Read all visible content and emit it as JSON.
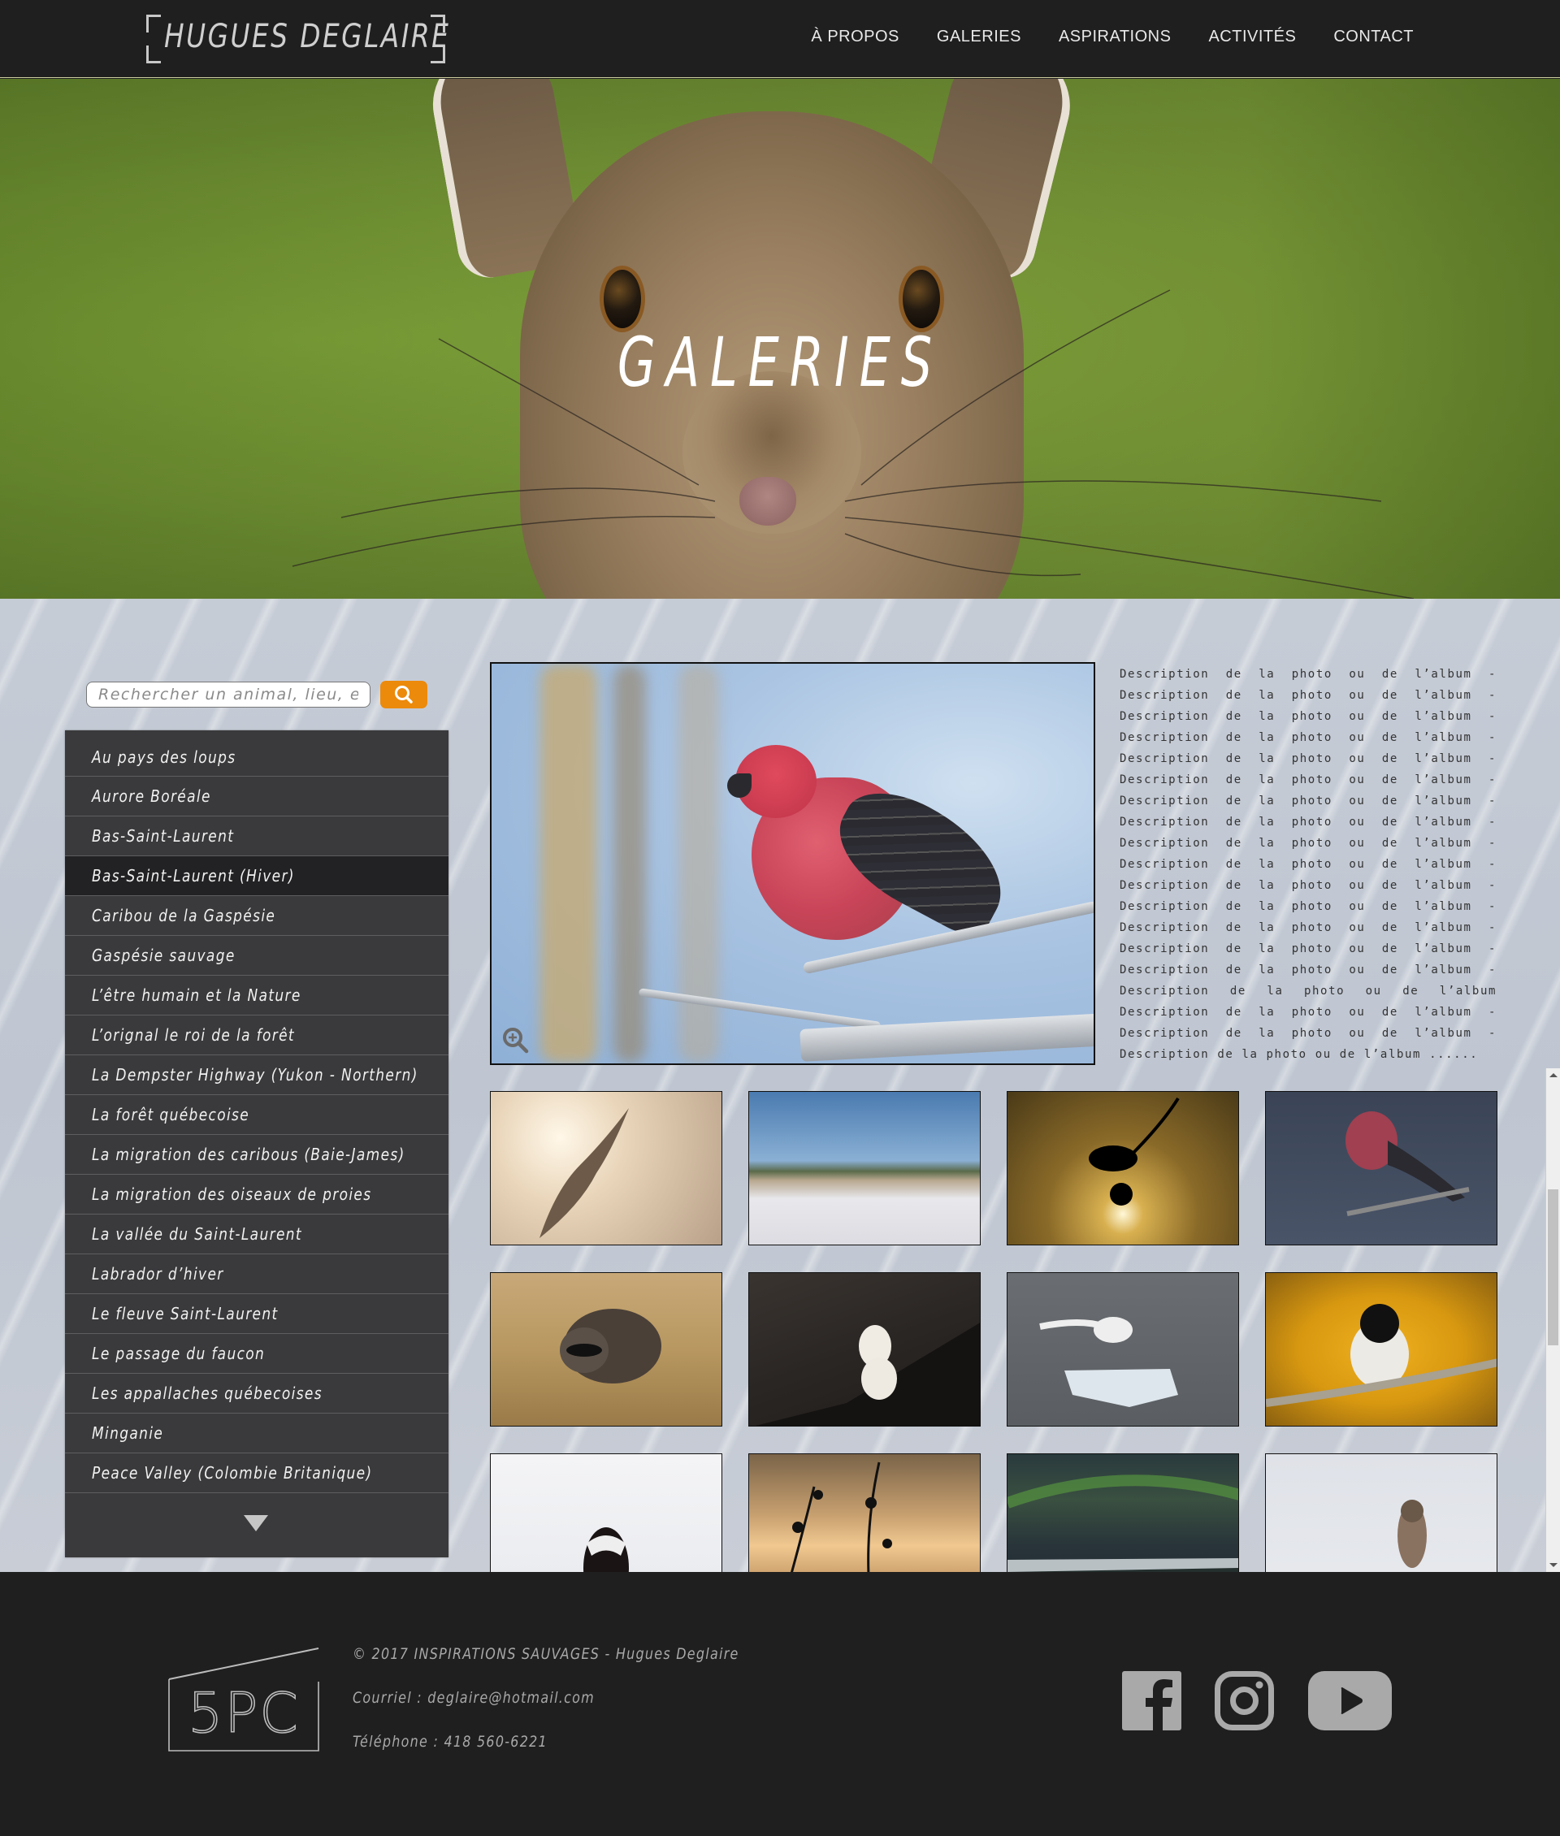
{
  "header": {
    "logo": "HUGUES DEGLAIRE",
    "nav": [
      {
        "label": "À  PROPOS"
      },
      {
        "label": "GALERIES"
      },
      {
        "label": "ASPIRATIONS"
      },
      {
        "label": "ACTIVITÉS"
      },
      {
        "label": "CONTACT"
      }
    ]
  },
  "hero": {
    "title": "GALERIES"
  },
  "search": {
    "placeholder": "Rechercher un animal, lieu, etc.",
    "value": "",
    "button_icon": "search-icon"
  },
  "galleries": {
    "items": [
      {
        "label": "Au pays des loups"
      },
      {
        "label": "Aurore Boréale"
      },
      {
        "label": "Bas-Saint-Laurent"
      },
      {
        "label": "Bas-Saint-Laurent (Hiver)",
        "active": true
      },
      {
        "label": "Caribou de la Gaspésie"
      },
      {
        "label": "Gaspésie sauvage"
      },
      {
        "label": "L’être humain et la Nature"
      },
      {
        "label": "L’orignal le roi de la forêt"
      },
      {
        "label": "La Dempster Highway (Yukon - Northern)"
      },
      {
        "label": "La forêt québecoise"
      },
      {
        "label": "La migration des caribous (Baie-James)"
      },
      {
        "label": "La migration des oiseaux de proies"
      },
      {
        "label": "La vallée du Saint-Laurent"
      },
      {
        "label": "Labrador d’hiver"
      },
      {
        "label": "Le fleuve Saint-Laurent"
      },
      {
        "label": "Le passage du faucon"
      },
      {
        "label": "Les appallaches québecoises"
      },
      {
        "label": "Minganie"
      },
      {
        "label": "Peace Valley (Colombie Britanique)"
      }
    ],
    "more_icon": "chevron-down-icon"
  },
  "featured": {
    "subject": "Pine grosbeak on branch",
    "zoom_icon": "zoom-in-icon",
    "description": "Description de la photo ou de l’album - Description de la photo ou de l’album - Description de la photo ou de l’album - Description de la photo ou de l’album - Description de la photo ou de l’album - Description de la photo ou de l’album - Description de la photo ou de l’album - Description de la photo ou de l’album - Description de la photo ou de l’album - Description de la photo ou de l’album - Description de la photo ou de l’album - Description de la photo ou de l’album - Description de la photo ou de l’album - Description de la photo ou de l’album - Description de la photo ou de l’album - Description de la photo ou de l’album Description de la photo ou de l’album - Description de la photo ou de l’album - Description de la photo ou de l’album ......"
  },
  "thumbnails": [
    {
      "subject": "Gull in flight against sun"
    },
    {
      "subject": "Flock of snow geese over field"
    },
    {
      "subject": "Bird silhouette against sun"
    },
    {
      "subject": "Pine grosbeak"
    },
    {
      "subject": "Raccoon in grass"
    },
    {
      "subject": "Ermine on rock"
    },
    {
      "subject": "Gull on ice floe"
    },
    {
      "subject": "Chickadee on branch"
    },
    {
      "subject": "Skunk in snow"
    },
    {
      "subject": "Sunset through branches"
    },
    {
      "subject": "Aurora over icy shore"
    },
    {
      "subject": "Coyote walking in snow"
    }
  ],
  "footer": {
    "logo": "5PC",
    "copyright": "© 2017 INSPIRATIONS SAUVAGES - Hugues Deglaire",
    "email": "Courriel : deglaire@hotmail.com",
    "phone": "Téléphone : 418 560-6221",
    "social": [
      {
        "name": "facebook-icon"
      },
      {
        "name": "instagram-icon"
      },
      {
        "name": "youtube-icon"
      }
    ]
  },
  "colors": {
    "header_bg": "#1f1f1f",
    "accent": "#ec8a0b",
    "list_bg": "#3a3a3c",
    "list_active": "#222224",
    "footer_text": "#a9a9a9"
  }
}
